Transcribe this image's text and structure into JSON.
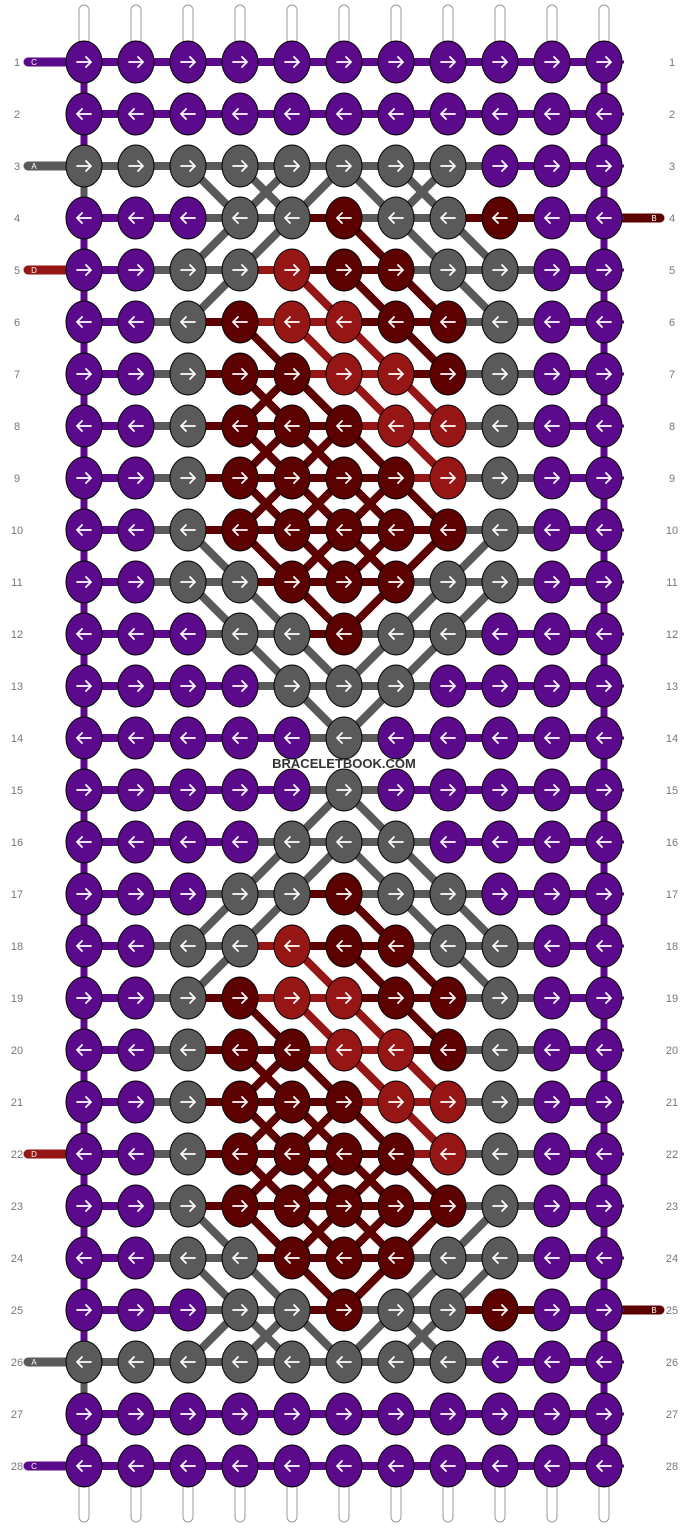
{
  "watermark": "BRACELETBOOK.COM",
  "colors": {
    "A": "#5a5a5a",
    "B": "#5c0000",
    "C": "#5a0a8a",
    "D": "#961515"
  },
  "row_labels": [
    "1",
    "2",
    "3",
    "4",
    "5",
    "6",
    "7",
    "8",
    "9",
    "10",
    "11",
    "12",
    "13",
    "14",
    "15",
    "16",
    "17",
    "18",
    "19",
    "20",
    "21",
    "22",
    "23",
    "24",
    "25",
    "26",
    "27",
    "28"
  ],
  "string_tags": [
    {
      "row": 1,
      "side": "left",
      "label": "C",
      "color": "C"
    },
    {
      "row": 3,
      "side": "left",
      "label": "A",
      "color": "A"
    },
    {
      "row": 4,
      "side": "right",
      "label": "B",
      "color": "B"
    },
    {
      "row": 5,
      "side": "left",
      "label": "D",
      "color": "D"
    },
    {
      "row": 22,
      "side": "left",
      "label": "D",
      "color": "D"
    },
    {
      "row": 25,
      "side": "right",
      "label": "B",
      "color": "B"
    },
    {
      "row": 26,
      "side": "left",
      "label": "A",
      "color": "A"
    },
    {
      "row": 28,
      "side": "left",
      "label": "C",
      "color": "C"
    }
  ],
  "knots": [
    "CCCCCCCCCCC",
    "CCCCCCCCCCC",
    "AAAAAAAACCC",
    "CCCAABAABCC",
    "CCAADBBAACC",
    "CCABDDBBACC",
    "CCABBDDBACC",
    "CCABBBDDACC",
    "CCABBBBDACC",
    "CCABBBBBACC",
    "CCAABBBAACC",
    "CCCAABAACCC",
    "CCCCAAACCCC",
    "CCCCCACCCCC",
    "CCCCCACCCCC",
    "CCCCAAACCCC",
    "CCCAABAACCC",
    "CCAADBBAACC",
    "CCABDDBBACC",
    "CCABBDDBACC",
    "CCABBBDDACC",
    "CCABBBBDACC",
    "CCABBBBBACC",
    "CCAABBBAACC",
    "CCCAABAABCC",
    "AAAAAAAACCC",
    "CCCCCCCCCCC",
    "CCCCCCCCCCC"
  ]
}
